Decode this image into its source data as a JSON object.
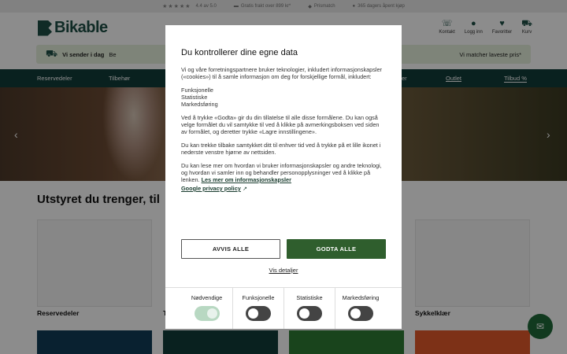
{
  "topbar": {
    "rating": "4.4 av 5.0",
    "freight": "Gratis frakt over 899 kr*",
    "pricematch": "Prismatch",
    "returns": "365 dagers åpent kjøp"
  },
  "header": {
    "logo": "Bikable",
    "icons": [
      {
        "label": "Kontakt",
        "icon": "headset-icon"
      },
      {
        "label": "Logg inn",
        "icon": "user-icon"
      },
      {
        "label": "Favoritter",
        "icon": "heart-icon"
      },
      {
        "label": "Kurv",
        "icon": "cart-icon"
      }
    ]
  },
  "promo": {
    "left_bold": "Vi sender i dag",
    "left_rest": "Be",
    "right": "Vi matcher laveste pris*"
  },
  "nav": {
    "items": [
      "Reservedeler",
      "Tilbehør",
      "er",
      "Outlet",
      "Tilbud %"
    ]
  },
  "main": {
    "section_title": "Utstyret du trenger, til",
    "cards": [
      "Reservedeler",
      "T",
      "Sykkelklær"
    ]
  },
  "consent": {
    "title": "Du kontrollerer dine egne data",
    "intro": "Vi og våre forretningspartnere bruker teknologier, inkludert informasjonskapsler («cookies») til å samle informasjon om deg for forskjellige formål, inkludert:",
    "purposes": [
      "Funksjonelle",
      "Statistiske",
      "Markedsføring"
    ],
    "p2": "Ved å trykke «Godta» gir du din tillatelse til alle disse formålene. Du kan også velge formålet du vil samtykke til ved å klikke på avmerkingsboksen ved siden av formålet, og deretter trykke «Lagre innstillingene».",
    "p3": "Du kan trekke tilbake samtykket ditt til enhver tid ved å trykke på et lille ikonet i nederste venstre hjørne av nettsiden.",
    "p4": "Du kan lese mer om hvordan vi bruker informasjonskapsler og andre teknologi, og hvordan vi samler inn og behandler personopplysninger ved å klikke på lenken.",
    "more_link": "Les mer om informasjonskapsler",
    "google_link": "Google privacy policy",
    "reject_label": "AVVIS ALLE",
    "accept_label": "GODTA ALLE",
    "details_label": "Vis detaljer",
    "toggles": [
      {
        "label": "Nødvendige",
        "on": true
      },
      {
        "label": "Funksjonelle",
        "on": false
      },
      {
        "label": "Statistiske",
        "on": false
      },
      {
        "label": "Markedsføring",
        "on": false
      }
    ]
  },
  "colors": {
    "brand": "#1e4f46",
    "nav": "#123d3a",
    "accept": "#2f5e2d",
    "promo": "#e6f0dc"
  }
}
